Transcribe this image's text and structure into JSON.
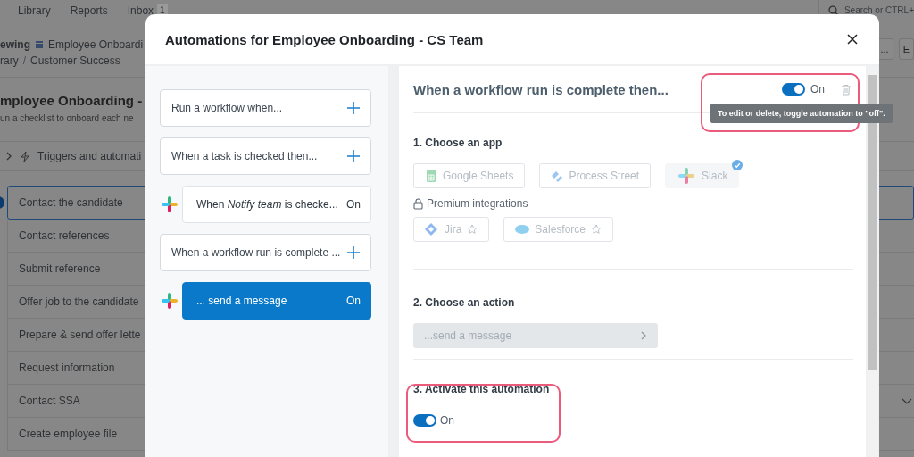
{
  "background": {
    "nav": [
      {
        "label": "Library"
      },
      {
        "label": "Reports"
      },
      {
        "label": "Inbox",
        "badge": "1"
      }
    ],
    "search": {
      "placeholder": "Search or CTRL+"
    },
    "breadcrumb": {
      "mode": "ewing",
      "workflow": "Employee Onboardi",
      "path": [
        "rary",
        "Customer Success"
      ],
      "separator": "/"
    },
    "buttons": [
      "...",
      "E"
    ],
    "title": "mployee Onboarding -",
    "description": "un a checklist to onboard each ne",
    "triggers_label": "Triggers and automati",
    "tasks": [
      {
        "label": "Contact the candidate",
        "selected": true,
        "dropdown": false
      },
      {
        "label": "Contact references",
        "selected": false,
        "dropdown": false
      },
      {
        "label": "Submit reference",
        "selected": false,
        "dropdown": false
      },
      {
        "label": "Offer job to the candidate",
        "selected": false,
        "dropdown": false
      },
      {
        "label": "Prepare & send offer lette",
        "selected": false,
        "dropdown": false
      },
      {
        "label": "Request information",
        "selected": false,
        "dropdown": false
      },
      {
        "label": "Contact SSA",
        "selected": false,
        "dropdown": true
      },
      {
        "label": "Create employee file",
        "selected": false,
        "dropdown": false
      }
    ]
  },
  "modal": {
    "title": "Automations for Employee Onboarding - CS Team",
    "automations": [
      {
        "kind": "trigger",
        "label": "Run a workflow when..."
      },
      {
        "kind": "trigger",
        "label": "When a task is checked then..."
      },
      {
        "kind": "action",
        "label": "When *Notify team* is checke...",
        "status": "On",
        "selected": false
      },
      {
        "kind": "trigger",
        "label": "When a workflow run is complete ..."
      },
      {
        "kind": "action",
        "label": "... send a message",
        "status": "On",
        "selected": true
      }
    ],
    "detail": {
      "title": "When a workflow run is complete then...",
      "toggle": {
        "on": true,
        "label": "On"
      },
      "tooltip": "To edit or delete, toggle automation to \"off\".",
      "step1": "1. Choose an app",
      "apps": [
        {
          "label": "Google Sheets",
          "selected": false
        },
        {
          "label": "Process Street",
          "selected": false
        },
        {
          "label": "Slack",
          "selected": true
        }
      ],
      "premium_label": "Premium integrations",
      "premium_apps": [
        {
          "label": "Jira"
        },
        {
          "label": "Salesforce"
        }
      ],
      "step2": "2. Choose an action",
      "action_field": {
        "value": "...send a message"
      },
      "step3": "3. Activate this automation",
      "activate": {
        "on": true,
        "label": "On"
      }
    }
  }
}
